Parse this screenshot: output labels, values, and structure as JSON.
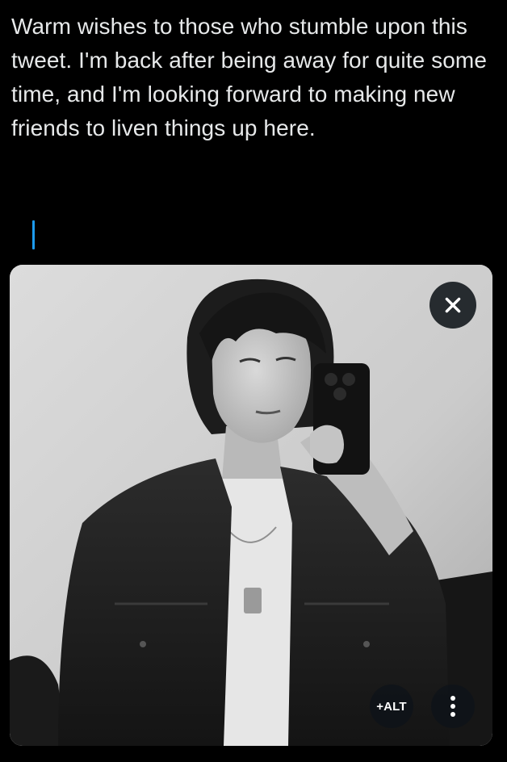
{
  "composer": {
    "tweet_text": "Warm wishes to those who stumble upon this tweet. I'm back after being away for quite some time, and I'm looking forward to making new friends to liven things up here.",
    "caret_color": "#1d9bf0"
  },
  "media": {
    "alt_label": "+ALT",
    "close_icon": "close-icon",
    "more_icon": "more-vertical-icon"
  },
  "colors": {
    "background": "#000000",
    "text": "#e7e9ea",
    "accent": "#1d9bf0"
  }
}
